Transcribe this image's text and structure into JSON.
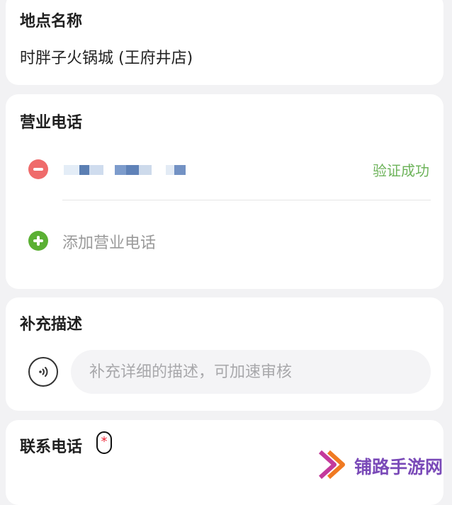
{
  "location": {
    "title": "地点名称",
    "value": "时胖子火锅城 (王府井店)"
  },
  "business_phone": {
    "title": "营业电话",
    "entries": [
      {
        "status": "验证成功"
      }
    ],
    "add_label": "添加营业电话"
  },
  "description": {
    "title": "补充描述",
    "placeholder": "补充详细的描述，可加速审核"
  },
  "contact_phone": {
    "title": "联系电话",
    "required_mark": "*"
  },
  "watermark": {
    "text": "铺路手游网"
  },
  "colors": {
    "background": "#f2f2f4",
    "success": "#6db35a",
    "remove": "#ef6b6b",
    "add": "#5bb034",
    "required": "#e22233"
  }
}
